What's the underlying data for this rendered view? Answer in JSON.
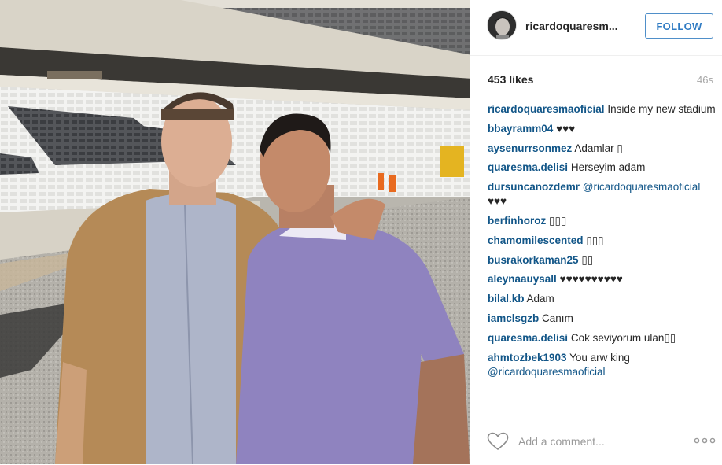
{
  "header": {
    "username": "ricardoquaresm...",
    "follow_label": "FOLLOW"
  },
  "stats": {
    "likes": "453 likes",
    "time": "46s"
  },
  "comments": [
    {
      "user": "ricardoquaresmaoficial",
      "text": "Inside my new stadium"
    },
    {
      "user": "bbayramm04",
      "text": "♥♥♥"
    },
    {
      "user": "aysenurrsonmez",
      "text": "Adamlar ▯"
    },
    {
      "user": "quaresma.delisi",
      "text": "Herseyim adam"
    },
    {
      "user": "dursuncanozdemr",
      "mention": "@ricardoquaresmaoficial",
      "text": " ♥♥♥"
    },
    {
      "user": "berfinhoroz",
      "text": "▯▯▯"
    },
    {
      "user": "chamomilescented",
      "text": "▯▯▯"
    },
    {
      "user": "busrakorkaman25",
      "text": "▯▯"
    },
    {
      "user": "aleynaauysall",
      "text": "♥♥♥♥♥♥♥♥♥♥"
    },
    {
      "user": "bilal.kb",
      "text": "Adam"
    },
    {
      "user": "iamclsgzb",
      "text": "Canım"
    },
    {
      "user": "quaresma.delisi",
      "text": "Cok seviyorum ulan▯▯"
    },
    {
      "user": "ahmtozbek1903",
      "text": "You arw king ",
      "mention": "@ricardoquaresmaoficial"
    }
  ],
  "footer": {
    "add_comment_placeholder": "Add a comment..."
  },
  "icons": {
    "like": "heart-outline-icon",
    "more": "ellipsis-icon"
  },
  "colors": {
    "link": "#125688",
    "follow_border": "#4f8fc9",
    "follow_text": "#2f7bc3",
    "muted": "#999999"
  }
}
